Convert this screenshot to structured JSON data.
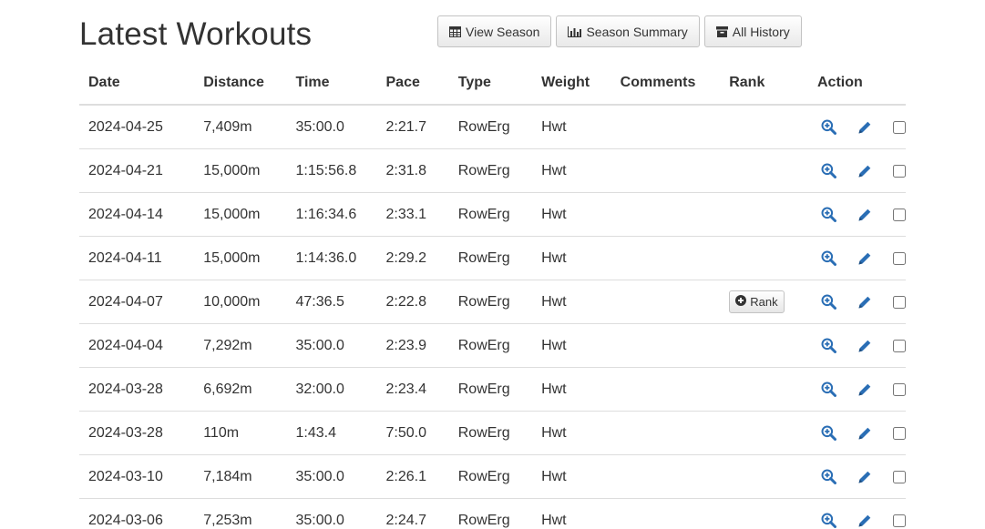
{
  "page": {
    "title": "Latest Workouts"
  },
  "toolbar": {
    "buttons": [
      {
        "label": "View Season",
        "icon": "table-icon"
      },
      {
        "label": "Season Summary",
        "icon": "bar-chart-icon"
      },
      {
        "label": "All History",
        "icon": "archive-icon"
      }
    ]
  },
  "table": {
    "headers": [
      "Date",
      "Distance",
      "Time",
      "Pace",
      "Type",
      "Weight",
      "Comments",
      "Rank",
      "Action"
    ],
    "rank_button_label": "Rank",
    "rows": [
      {
        "date": "2024-04-25",
        "distance": "7,409m",
        "time": "35:00.0",
        "pace": "2:21.7",
        "type": "RowErg",
        "weight": "Hwt",
        "comments": "",
        "rank": false
      },
      {
        "date": "2024-04-21",
        "distance": "15,000m",
        "time": "1:15:56.8",
        "pace": "2:31.8",
        "type": "RowErg",
        "weight": "Hwt",
        "comments": "",
        "rank": false
      },
      {
        "date": "2024-04-14",
        "distance": "15,000m",
        "time": "1:16:34.6",
        "pace": "2:33.1",
        "type": "RowErg",
        "weight": "Hwt",
        "comments": "",
        "rank": false
      },
      {
        "date": "2024-04-11",
        "distance": "15,000m",
        "time": "1:14:36.0",
        "pace": "2:29.2",
        "type": "RowErg",
        "weight": "Hwt",
        "comments": "",
        "rank": false
      },
      {
        "date": "2024-04-07",
        "distance": "10,000m",
        "time": "47:36.5",
        "pace": "2:22.8",
        "type": "RowErg",
        "weight": "Hwt",
        "comments": "",
        "rank": true
      },
      {
        "date": "2024-04-04",
        "distance": "7,292m",
        "time": "35:00.0",
        "pace": "2:23.9",
        "type": "RowErg",
        "weight": "Hwt",
        "comments": "",
        "rank": false
      },
      {
        "date": "2024-03-28",
        "distance": "6,692m",
        "time": "32:00.0",
        "pace": "2:23.4",
        "type": "RowErg",
        "weight": "Hwt",
        "comments": "",
        "rank": false
      },
      {
        "date": "2024-03-28",
        "distance": "110m",
        "time": "1:43.4",
        "pace": "7:50.0",
        "type": "RowErg",
        "weight": "Hwt",
        "comments": "",
        "rank": false
      },
      {
        "date": "2024-03-10",
        "distance": "7,184m",
        "time": "35:00.0",
        "pace": "2:26.1",
        "type": "RowErg",
        "weight": "Hwt",
        "comments": "",
        "rank": false
      },
      {
        "date": "2024-03-06",
        "distance": "7,253m",
        "time": "35:00.0",
        "pace": "2:24.7",
        "type": "RowErg",
        "weight": "Hwt",
        "comments": "",
        "rank": false
      }
    ]
  },
  "colors": {
    "action_icon": "#2a6eb5",
    "border": "#dddddd",
    "text": "#333333"
  }
}
